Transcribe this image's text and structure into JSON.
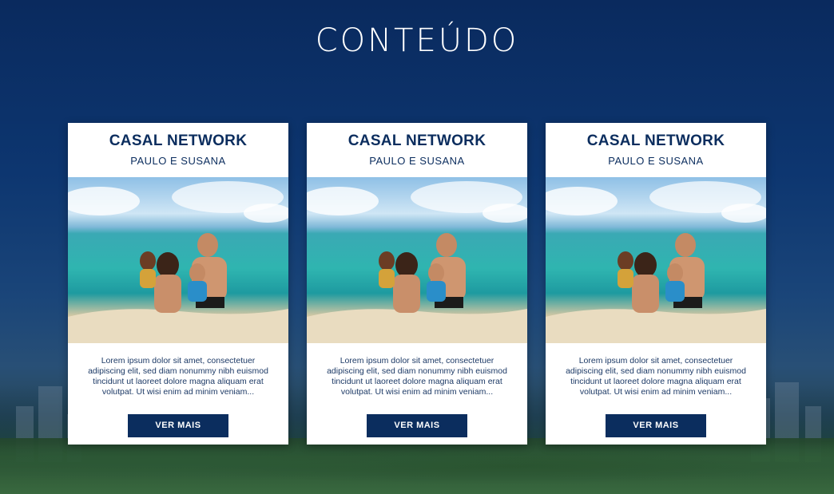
{
  "section": {
    "title": "CONTEÚDO"
  },
  "cards": [
    {
      "name": "CASAL NETWORK",
      "subtitle": "PAULO E SUSANA",
      "text": "Lorem ipsum dolor sit amet, consectetuer adipiscing elit, sed diam nonummy nibh euismod tincidunt ut laoreet dolore magna aliquam erat volutpat. Ut wisi enim ad minim veniam...",
      "button": "VER MAIS"
    },
    {
      "name": "CASAL NETWORK",
      "subtitle": "PAULO E SUSANA",
      "text": "Lorem ipsum dolor sit amet, consectetuer adipiscing elit, sed diam nonummy nibh euismod tincidunt ut laoreet dolore magna aliquam erat volutpat. Ut wisi enim ad minim veniam...",
      "button": "VER MAIS"
    },
    {
      "name": "CASAL NETWORK",
      "subtitle": "PAULO E SUSANA",
      "text": "Lorem ipsum dolor sit amet, consectetuer adipiscing elit, sed diam nonummy nibh euismod tincidunt ut laoreet dolore magna aliquam erat volutpat. Ut wisi enim ad minim veniam...",
      "button": "VER MAIS"
    }
  ],
  "colors": {
    "brand": "#0b2d5e",
    "text": "#1d3a66",
    "background": "#0d3670"
  }
}
